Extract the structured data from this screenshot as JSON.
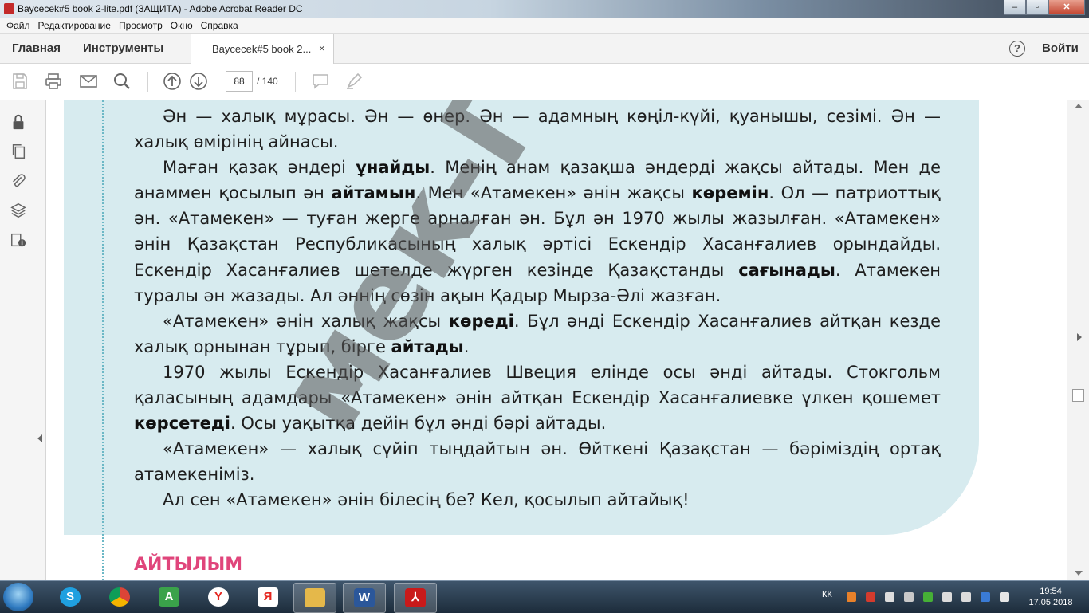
{
  "window": {
    "title": "Baycecek#5 book 2-lite.pdf (ЗАЩИТА) - Adobe Acrobat Reader DC"
  },
  "menu": [
    "Файл",
    "Редактирование",
    "Просмотр",
    "Окно",
    "Справка"
  ],
  "tabs": {
    "home": "Главная",
    "tools": "Инструменты",
    "document": "Baycecek#5 book 2...",
    "close_glyph": "×",
    "help_glyph": "?",
    "signin": "Войти"
  },
  "toolbar": {
    "page_current": "88",
    "page_total": "/ 140",
    "icons": [
      "save-icon",
      "print-icon",
      "email-icon",
      "search-icon",
      "page-up-icon",
      "page-down-icon",
      "comment-icon",
      "highlight-pen-icon"
    ]
  },
  "left_panel": {
    "icons": [
      "lock-icon",
      "pages-icon",
      "attachment-icon",
      "layers-icon",
      "security-info-icon"
    ]
  },
  "document": {
    "paragraphs": [
      [
        {
          "t": "Ән — халық мұрасы. Ән — өнер. Ән — адамның көңіл-күйі, қуанышы, сезімі. Ән — халық өмірінің айнасы.",
          "b": false
        }
      ],
      [
        {
          "t": "Маған қазақ әндері ",
          "b": false
        },
        {
          "t": "ұнайды",
          "b": true
        },
        {
          "t": ". Менің анам қазақша әндерді жақсы айтады. Мен де анаммен қосылып ән ",
          "b": false
        },
        {
          "t": "айтамын",
          "b": true
        },
        {
          "t": ". Мен «Атамекен» әнін жақсы ",
          "b": false
        },
        {
          "t": "көремін",
          "b": true
        },
        {
          "t": ". Ол — патриоттық ән. «Атамекен» — туған жерге арналған ән. Бұл ән 1970 жылы жазылған. «Атамекен» әнін Қазақстан Республикасының халық әртісі Ескендір Хасанғалиев орындайды. Ескендір Хасанғалиев шетелде жүрген кезінде Қазақстанды ",
          "b": false
        },
        {
          "t": "сағынады",
          "b": true
        },
        {
          "t": ". Атамекен туралы ән жазады. Ал әннің сөзін ақын Қадыр Мырза-Әлі жазған.",
          "b": false
        }
      ],
      [
        {
          "t": "«Атамекен» әнін халық жақсы ",
          "b": false
        },
        {
          "t": "көреді",
          "b": true
        },
        {
          "t": ". Бұл әнді Ескендір Хасанғалиев айтқан кезде халық орнынан тұрып, бірге ",
          "b": false
        },
        {
          "t": "айтады",
          "b": true
        },
        {
          "t": ".",
          "b": false
        }
      ],
      [
        {
          "t": "1970 жылы Ескендір Хасанғалиев Швеция елінде осы әнді айтады. Стокгольм қаласының адамдары «Атамекен» әнін айтқан Ескендір Хасанғалиевке үлкен қошемет ",
          "b": false
        },
        {
          "t": "көрсетеді",
          "b": true
        },
        {
          "t": ". Осы уақытқа дейін бұл әнді бәрі айтады.",
          "b": false
        }
      ],
      [
        {
          "t": "«Атамекен» — халық сүйіп тыңдайтын ән. Өйткені Қазақстан — бәріміздің ортақ атамекеніміз.",
          "b": false
        }
      ],
      [
        {
          "t": "Ал сен «Атамекен» әнін білесің бе? Кел, қосылып айтайық!",
          "b": false
        }
      ]
    ],
    "watermark": "мек-Гориз",
    "section_heading": "АЙТЫЛЫМ"
  },
  "taskbar": {
    "apps": [
      "skype-icon",
      "chrome-icon",
      "alice-icon",
      "yandex-icon",
      "yandex-browser-icon",
      "file-explorer-icon",
      "word-icon",
      "acrobat-icon"
    ],
    "language": "КК",
    "time": "19:54",
    "date": "17.05.2018"
  },
  "colors": {
    "panel": "#d7ebef",
    "heading": "#e0457b",
    "dotted_line": "#6cb8c6"
  }
}
